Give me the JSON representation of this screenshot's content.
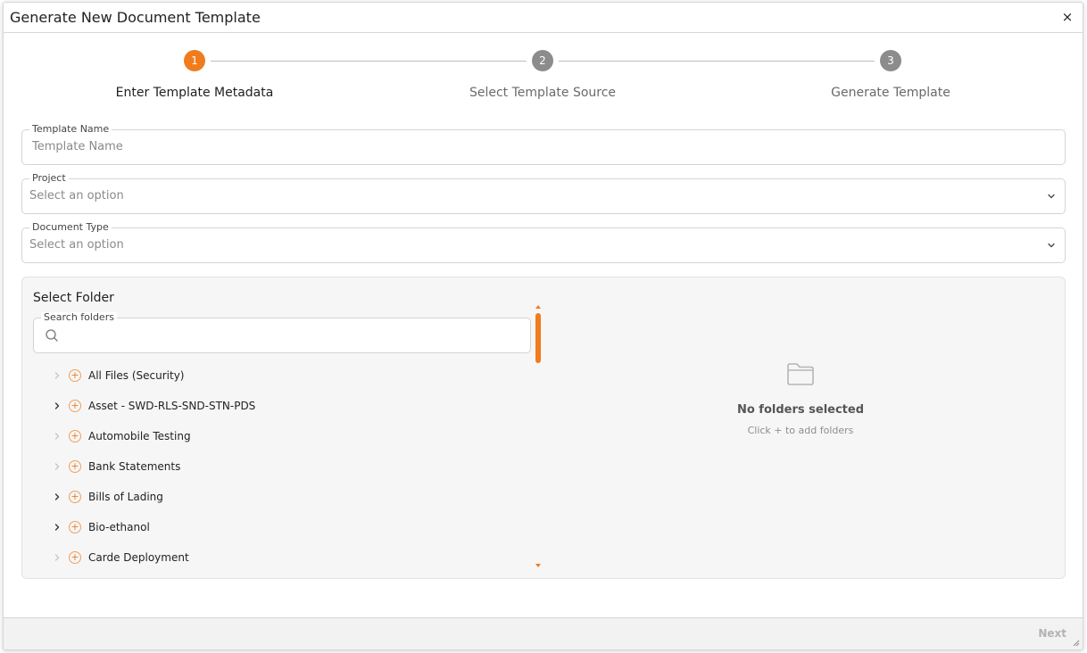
{
  "modal": {
    "title": "Generate New Document Template",
    "close_label": "×"
  },
  "stepper": {
    "steps": [
      {
        "number": "1",
        "label": "Enter Template Metadata",
        "active": true
      },
      {
        "number": "2",
        "label": "Select Template Source",
        "active": false
      },
      {
        "number": "3",
        "label": "Generate Template",
        "active": false
      }
    ]
  },
  "form": {
    "template_name": {
      "label": "Template Name",
      "placeholder": "Template Name",
      "value": ""
    },
    "project": {
      "label": "Project",
      "value": "Select an option"
    },
    "document_type": {
      "label": "Document Type",
      "value": "Select an option"
    }
  },
  "folders": {
    "title": "Select Folder",
    "search_label": "Search folders",
    "search_value": "",
    "tree": [
      {
        "label": "All Files (Security)",
        "expandable": false
      },
      {
        "label": "Asset - SWD-RLS-SND-STN-PDS",
        "expandable": true
      },
      {
        "label": "Automobile Testing",
        "expandable": false
      },
      {
        "label": "Bank Statements",
        "expandable": false
      },
      {
        "label": "Bills of Lading",
        "expandable": true
      },
      {
        "label": "Bio-ethanol",
        "expandable": true
      },
      {
        "label": "Carde Deployment",
        "expandable": false
      }
    ],
    "empty_title": "No folders selected",
    "empty_hint": "Click + to add folders"
  },
  "footer": {
    "next_label": "Next"
  },
  "colors": {
    "accent": "#f07c1e",
    "step_inactive": "#8c8c8c",
    "disabled_text": "#b3b3b3"
  },
  "icons": {
    "close": "close-icon",
    "select": "chevron-down-icon",
    "search": "search-icon",
    "tree_toggle": "chevron-right-icon",
    "tree_add": "plus-circle-icon",
    "empty": "folder-icon"
  }
}
